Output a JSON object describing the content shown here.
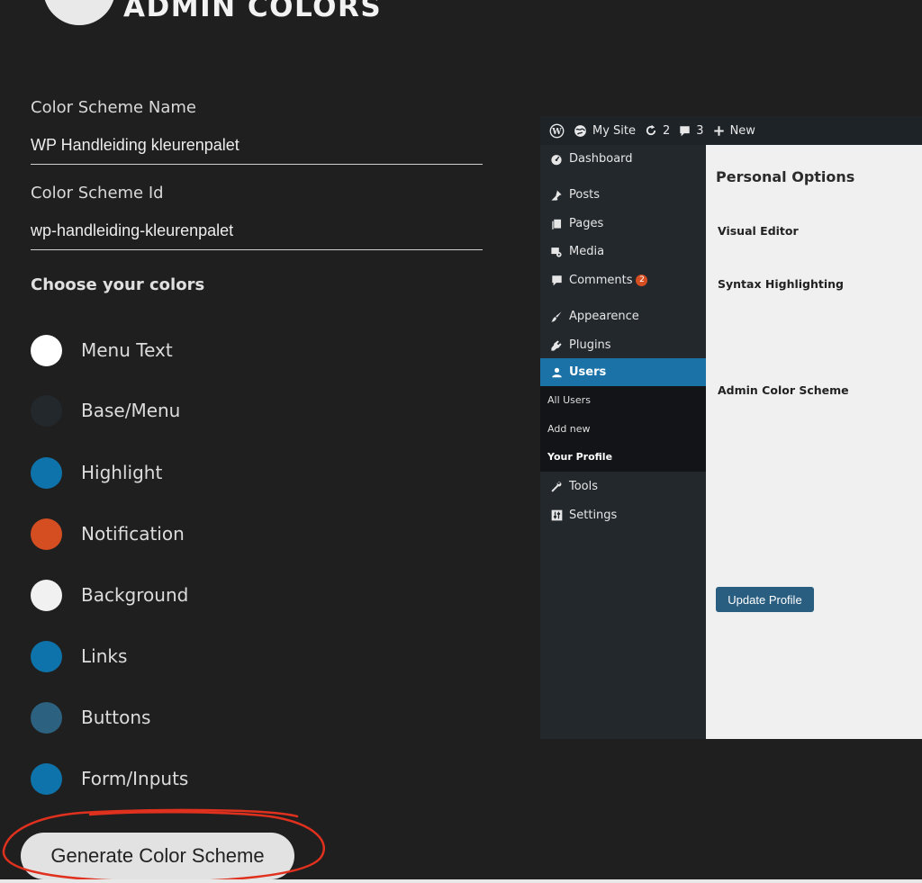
{
  "header": {
    "brand": "ADMIN COLORS"
  },
  "form": {
    "scheme_name_label": "Color Scheme Name",
    "scheme_name_value": "WP Handleiding kleurenpalet",
    "scheme_id_label": "Color Scheme Id",
    "scheme_id_value": "wp-handleiding-kleurenpalet",
    "choose_title": "Choose your colors",
    "colors": [
      {
        "label": "Menu Text",
        "hex": "#ffffff"
      },
      {
        "label": "Base/Menu",
        "hex": "#23282d"
      },
      {
        "label": "Highlight",
        "hex": "#0f73ab"
      },
      {
        "label": "Notification",
        "hex": "#d54e21"
      },
      {
        "label": "Background",
        "hex": "#f1f1f1"
      },
      {
        "label": "Links",
        "hex": "#0f73ab"
      },
      {
        "label": "Buttons",
        "hex": "#2c617f"
      },
      {
        "label": "Form/Inputs",
        "hex": "#0f73ab"
      }
    ],
    "generate_label": "Generate Color Scheme",
    "annotation_color": "#e0301e"
  },
  "preview": {
    "adminbar": {
      "site": "My Site",
      "updates": "2",
      "comments": "3",
      "new": "New"
    },
    "menu": {
      "dashboard": "Dashboard",
      "posts": "Posts",
      "pages": "Pages",
      "media": "Media",
      "comments": "Comments",
      "comments_badge": "2",
      "appearance": "Appearence",
      "plugins": "Plugins",
      "users": "Users",
      "sub_all_users": "All Users",
      "sub_add_new": "Add new",
      "sub_your_profile": "Your Profile",
      "tools": "Tools",
      "settings": "Settings"
    },
    "main": {
      "title": "Personal Options",
      "visual_editor": "Visual Editor",
      "syntax_highlighting": "Syntax Highlighting",
      "admin_color_scheme": "Admin Color Scheme",
      "update_button": "Update Profile"
    }
  }
}
